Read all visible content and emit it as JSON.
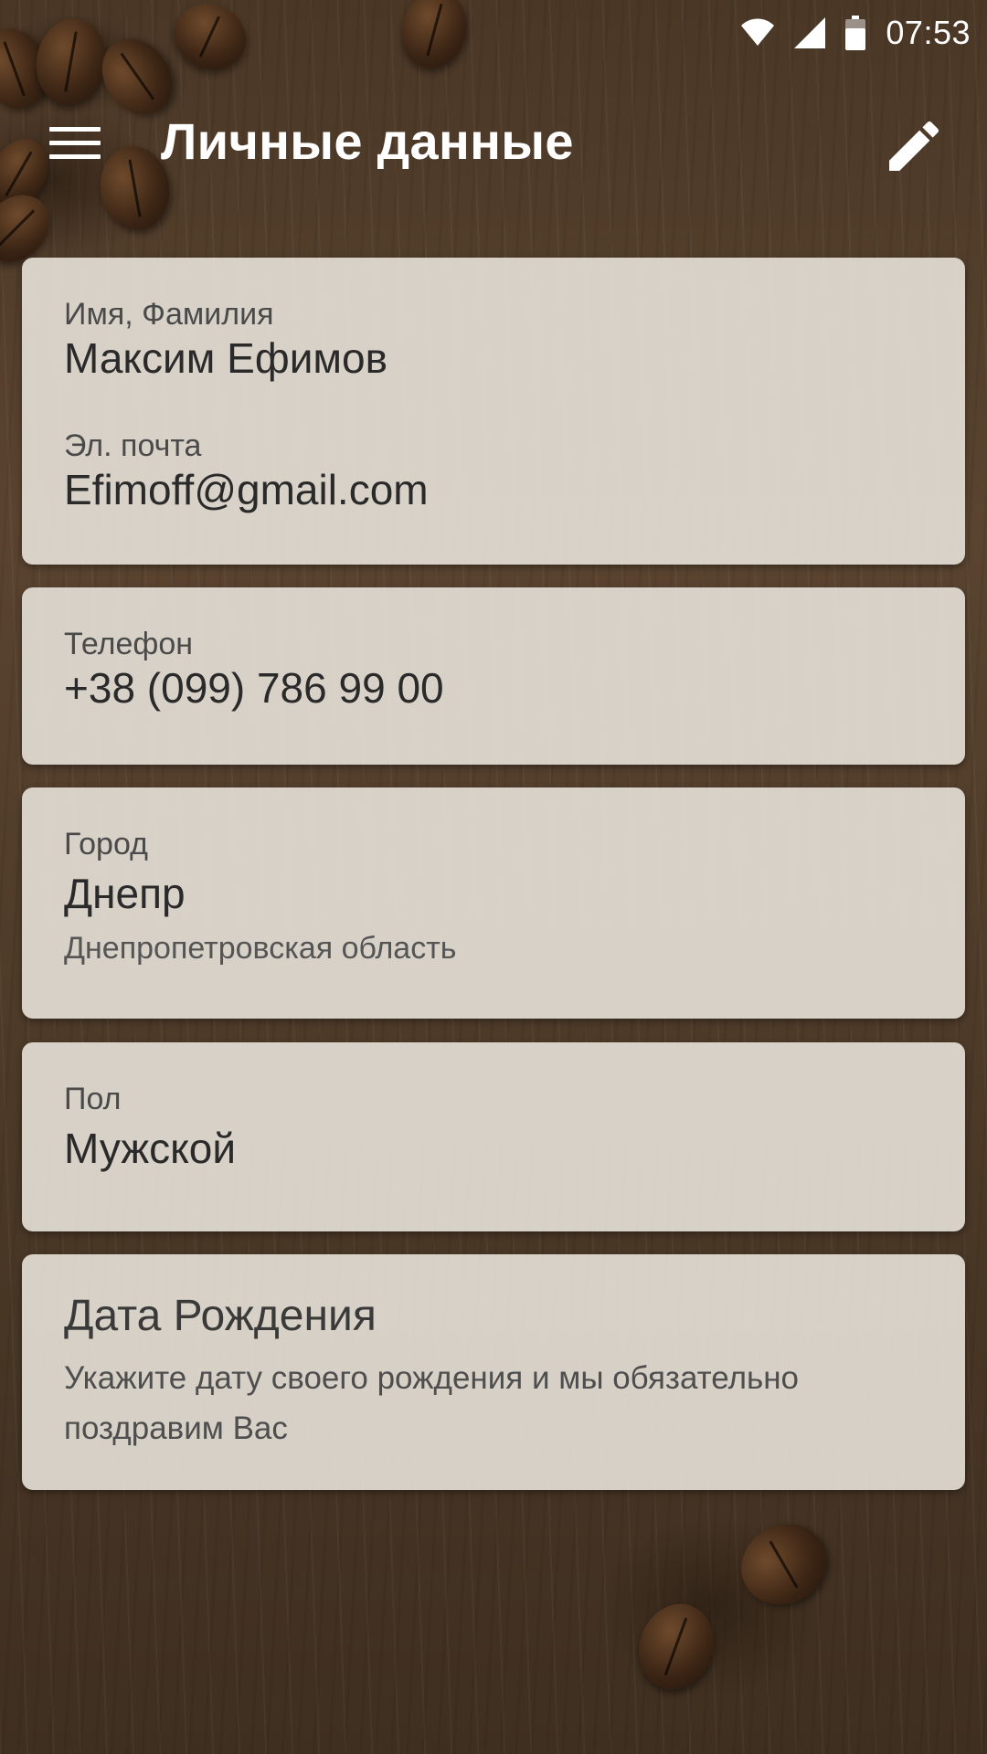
{
  "status_bar": {
    "time": "07:53",
    "icons": [
      "wifi-icon",
      "cell-signal-icon",
      "battery-icon"
    ]
  },
  "toolbar": {
    "title": "Личные данные",
    "menu_icon": "hamburger-menu-icon",
    "edit_icon": "pencil-edit-icon"
  },
  "profile": {
    "name_label": "Имя, Фамилия",
    "name_value": "Максим Ефимов",
    "email_label": "Эл. почта",
    "email_value": "Efimoff@gmail.com"
  },
  "phone": {
    "label": "Телефон",
    "value": "+38 (099) 786 99 00"
  },
  "city": {
    "label": "Город",
    "value": "Днепр",
    "region": "Днепропетровская область"
  },
  "gender": {
    "label": "Пол",
    "value": "Мужской"
  },
  "birthday": {
    "title": "Дата Рождения",
    "description": "Укажите дату своего рождения и мы обязательно поздравим Вас"
  },
  "colors": {
    "card_background": "#e2ddd4",
    "toolbar_text": "#ffffff",
    "background_wood": "#4a3726"
  }
}
